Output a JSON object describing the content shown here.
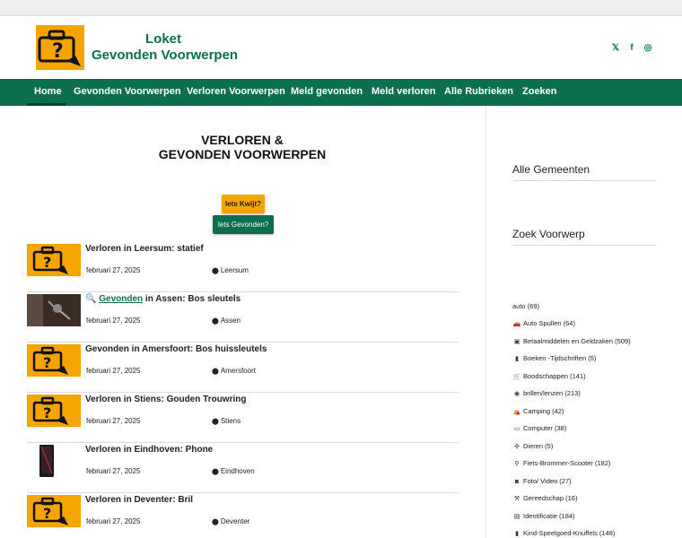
{
  "header": {
    "logo_line1": "Loket",
    "logo_line2": "Gevonden Voorwerpen",
    "social": [
      {
        "icon": "x-icon",
        "glyph": "𝕏"
      },
      {
        "icon": "facebook-icon",
        "glyph": "f"
      },
      {
        "icon": "instagram-icon",
        "glyph": "◎"
      }
    ]
  },
  "nav": {
    "items": [
      "Home",
      "Gevonden Voorwerpen",
      "Verloren Voorwerpen",
      "Meld gevonden",
      "Meld verloren",
      "Alle Rubrieken",
      "Zoeken"
    ]
  },
  "hero": {
    "title_line1": "VERLOREN &",
    "title_line2": "GEVONDEN VOORWERPEN",
    "btn_lost": "Iets Kwijt?",
    "btn_found": "Iets Gevonden?"
  },
  "posts": [
    {
      "title": "Verloren in Leersum: statief",
      "date": "februari 27, 2025",
      "location": "Leersum",
      "thumb": "logo"
    },
    {
      "title_prefix": "🔍 ",
      "title_link": "Gevonden",
      "title_rest": " in Assen: Bos sleutels",
      "date": "februari 27, 2025",
      "location": "Assen",
      "thumb": "keys"
    },
    {
      "title": "Gevonden in Amersfoort: Bos huissleutels",
      "date": "februari 27, 2025",
      "location": "Amersfoort",
      "thumb": "logo"
    },
    {
      "title": "Verloren in Stiens: Gouden Trouwring",
      "date": "februari 27, 2025",
      "location": "Stiens",
      "thumb": "logo"
    },
    {
      "title": "Verloren in Eindhoven: Phone",
      "date": "februari 27, 2025",
      "location": "Eindhoven",
      "thumb": "phone"
    },
    {
      "title": "Verloren in Deventer: Bril",
      "date": "februari 27, 2025",
      "location": "Deventer",
      "thumb": "logo"
    }
  ],
  "sidebar": {
    "heading1": "Alle Gemeenten",
    "heading2": "Zoek Voorwerp",
    "categories": [
      {
        "label": "auto (69)",
        "icon": ""
      },
      {
        "label": "Auto Spullen (64)",
        "icon": "🚗"
      },
      {
        "label": "Betaalmiddelen en Geldzaken (509)",
        "icon": "▣"
      },
      {
        "label": "Boeken -Tijdschriften (5)",
        "icon": "▮"
      },
      {
        "label": "Boodschappen (141)",
        "icon": "🛒"
      },
      {
        "label": "brillen/lenzen (213)",
        "icon": "◉"
      },
      {
        "label": "Camping (42)",
        "icon": "⛺"
      },
      {
        "label": "Computer (38)",
        "icon": "▭"
      },
      {
        "label": "Dieren (5)",
        "icon": "✣"
      },
      {
        "label": "Fiets-Brommer-Scooter (182)",
        "icon": "⚲"
      },
      {
        "label": "Foto/ Video (27)",
        "icon": "◙"
      },
      {
        "label": "Gereedschap (16)",
        "icon": "⚒"
      },
      {
        "label": "Identificatie (184)",
        "icon": "▤"
      },
      {
        "label": "Kind-Speelgoed-Knuffels (148)",
        "icon": "▮"
      }
    ]
  },
  "colors": {
    "brand_green": "#0b6e4f",
    "accent_orange": "#f5a400"
  }
}
